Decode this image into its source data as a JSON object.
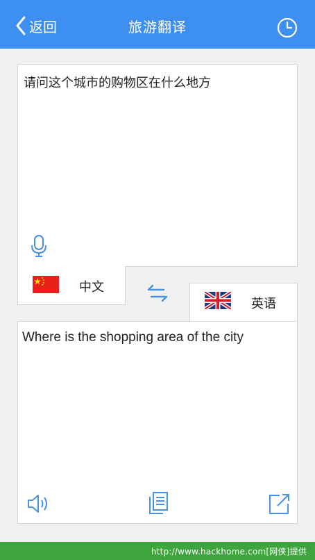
{
  "header": {
    "back_label": "返回",
    "title": "旅游翻译",
    "icons": {
      "back": "chevron-left-icon",
      "history": "clock-icon"
    }
  },
  "source": {
    "text": "请问这个城市的购物区在什么地方",
    "language": "中文",
    "flag": "china-flag-icon"
  },
  "target": {
    "text": "Where is the shopping area of the city",
    "language": "英语",
    "flag": "uk-flag-icon"
  },
  "actions": {
    "mic": "microphone-icon",
    "swap": "swap-icon",
    "speaker": "speaker-icon",
    "copy": "copy-icon",
    "share": "share-icon"
  },
  "footer": {
    "text": "http://www.hackhome.com[网侠]提供"
  },
  "colors": {
    "accent": "#3d8ff1",
    "footer": "#3ea53e",
    "background": "#f0f0f0"
  }
}
